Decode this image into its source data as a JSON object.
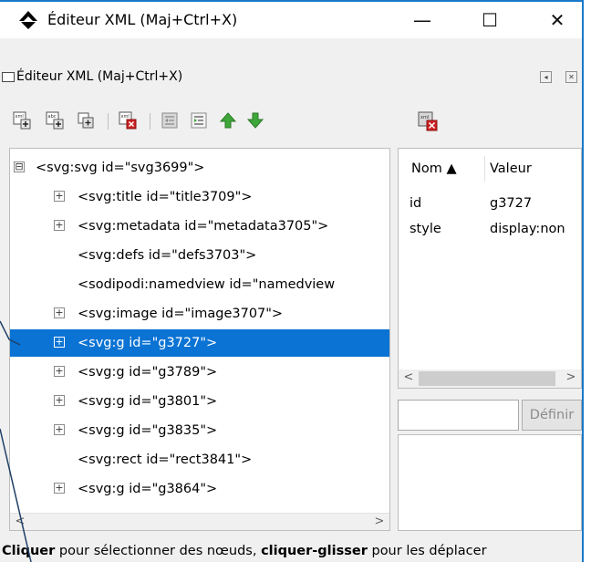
{
  "window": {
    "title": "Éditeur XML (Maj+Ctrl+X)",
    "minimize_glyph": "—",
    "maximize_glyph": "☐",
    "close_glyph": "✕"
  },
  "panel": {
    "title": "Éditeur XML (Maj+Ctrl+X)",
    "btn_left_glyph": "◂",
    "btn_close_glyph": "✕"
  },
  "toolbar": {
    "icons": [
      "new-element-node-icon",
      "new-text-node-icon",
      "duplicate-node-icon",
      "delete-node-icon",
      "unindent-node-icon",
      "indent-node-icon",
      "raise-node-icon",
      "lower-node-icon"
    ],
    "colors": {
      "arrow_up": "#3ea63a",
      "arrow_down": "#3ea63a",
      "delete": "#cc2222"
    }
  },
  "tree": {
    "nodes": [
      {
        "label": "<svg:svg id=\"svg3699\">",
        "expander": "⊟"
      },
      {
        "label": "<svg:title id=\"title3709\">",
        "expander": "+"
      },
      {
        "label": "<svg:metadata id=\"metadata3705\">",
        "expander": "+"
      },
      {
        "label": "<svg:defs id=\"defs3703\">",
        "expander": ""
      },
      {
        "label": "<sodipodi:namedview id=\"namedview",
        "expander": ""
      },
      {
        "label": "<svg:image id=\"image3707\">",
        "expander": "+"
      },
      {
        "label": "<svg:g id=\"g3727\">",
        "expander": "+",
        "selected": true
      },
      {
        "label": "<svg:g id=\"g3789\">",
        "expander": "+"
      },
      {
        "label": "<svg:g id=\"g3801\">",
        "expander": "+"
      },
      {
        "label": "<svg:g id=\"g3835\">",
        "expander": "+"
      },
      {
        "label": "<svg:rect id=\"rect3841\">",
        "expander": ""
      },
      {
        "label": "<svg:g id=\"g3864\">",
        "expander": "+"
      }
    ],
    "scroll_left": "<",
    "scroll_right": ">",
    "selection_color": "#0a73d4"
  },
  "attributes": {
    "col_name": "Nom ▲",
    "col_value": "Valeur",
    "rows": [
      {
        "name": "id",
        "value": "g3727"
      },
      {
        "name": "style",
        "value": "display:non"
      }
    ],
    "scroll_left": "<",
    "scroll_right": ">"
  },
  "editor": {
    "value": "",
    "define_label": "Définir"
  },
  "status": {
    "p1": "Cliquer",
    "p2": " pour sélectionner des nœuds, ",
    "p3": "cliquer-glisser",
    "p4": " pour les déplacer"
  },
  "accent": "#1979ca"
}
